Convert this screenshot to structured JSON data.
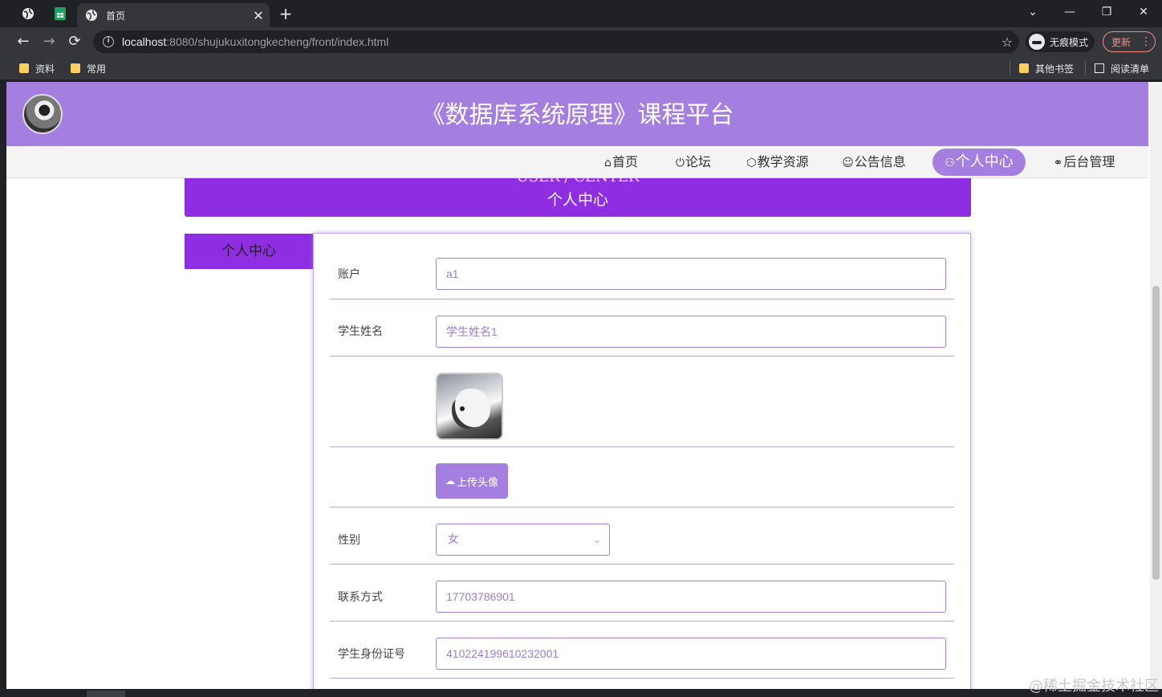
{
  "browser": {
    "active_tab_title": "首页",
    "tab_close": "✕",
    "new_tab": "+",
    "url_host": "localhost",
    "url_rest": ":8080/shujukuxitongkecheng/front/index.html",
    "incognito_label": "无痕模式",
    "update_label": "更新",
    "bookmarks": [
      "资料",
      "常用"
    ],
    "other_bookmarks": "其他书签",
    "reading_list": "阅读清单"
  },
  "site": {
    "title": "《数据库系统原理》课程平台",
    "nav": [
      {
        "icon": "⌂",
        "label": "首页"
      },
      {
        "icon": "⏻",
        "label": "论坛"
      },
      {
        "icon": "⬡",
        "label": "教学资源"
      },
      {
        "icon": "☺",
        "label": "公告信息"
      },
      {
        "icon": "⚇",
        "label": "个人中心"
      },
      {
        "icon": "⚭",
        "label": "后台管理"
      }
    ],
    "active_nav": "个人中心"
  },
  "banner": {
    "en": "USER / CENTER",
    "zh": "个人中心"
  },
  "side_tab": "个人中心",
  "form": {
    "account_label": "账户",
    "account_value": "a1",
    "name_label": "学生姓名",
    "name_value": "学生姓名1",
    "upload_label": "上传头像",
    "gender_label": "性别",
    "gender_value": "女",
    "phone_label": "联系方式",
    "phone_value": "17703786901",
    "idcard_label": "学生身份证号",
    "idcard_value": "410224199610232001"
  },
  "watermark": "@稀土掘金技术社区",
  "colors": {
    "accent": "#a47fe0",
    "banner": "#8e2de2",
    "input_text": "#9a7ed4"
  }
}
